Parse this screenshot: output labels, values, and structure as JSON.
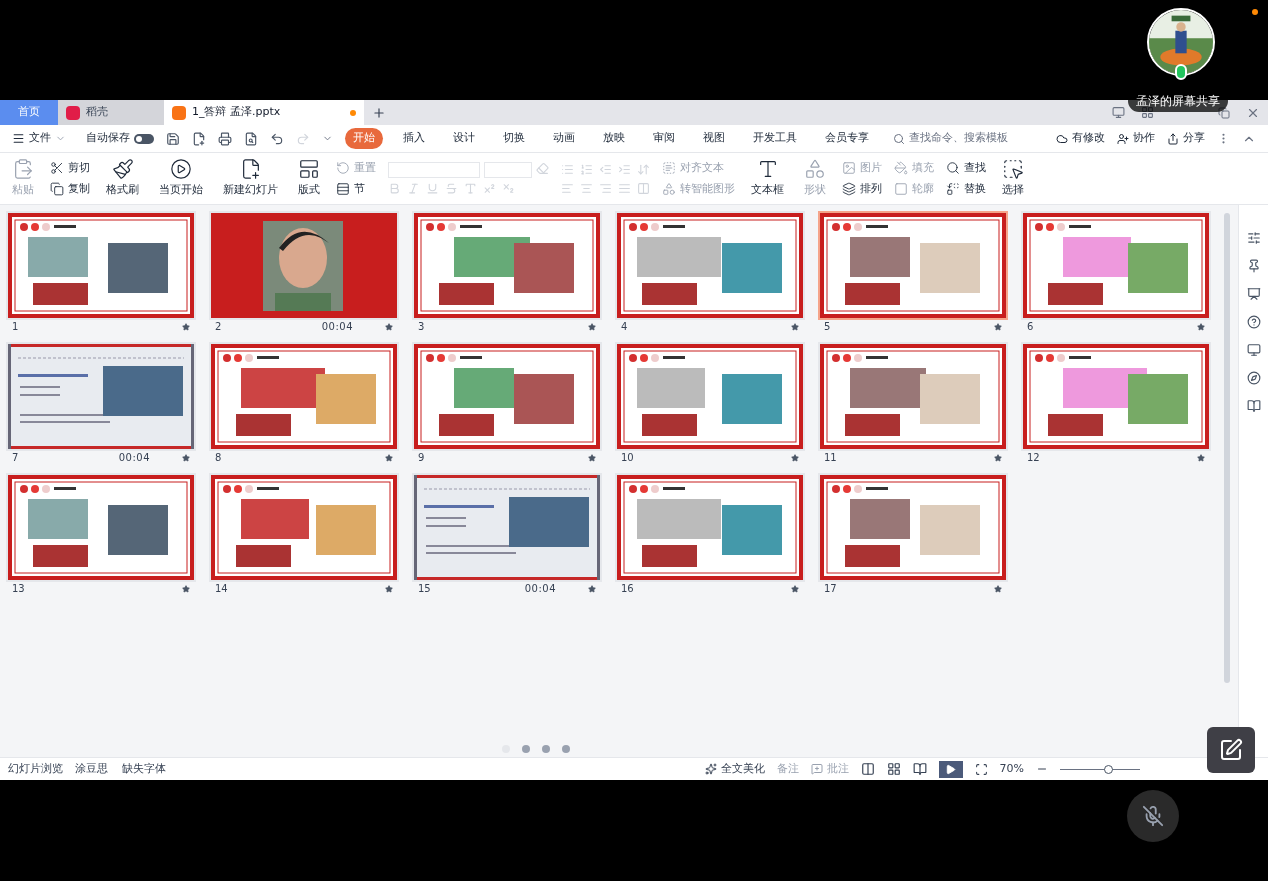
{
  "tabs": [
    {
      "label": "首页",
      "selected": false,
      "kind": "home"
    },
    {
      "label": "稻壳",
      "selected": false,
      "kind": "docer"
    },
    {
      "label": "1_答辩 孟泽.pptx",
      "selected": true,
      "kind": "file",
      "modified": true
    }
  ],
  "menu": {
    "file": "文件",
    "autosave": {
      "label": "自动保存",
      "on": false
    },
    "ribbon_tabs": [
      {
        "label": "开始",
        "selected": true
      },
      {
        "label": "插入",
        "selected": false
      },
      {
        "label": "设计",
        "selected": false
      },
      {
        "label": "切换",
        "selected": false
      },
      {
        "label": "动画",
        "selected": false
      },
      {
        "label": "放映",
        "selected": false
      },
      {
        "label": "审阅",
        "selected": false
      },
      {
        "label": "视图",
        "selected": false
      },
      {
        "label": "开发工具",
        "selected": false
      },
      {
        "label": "会员专享",
        "selected": false
      }
    ],
    "search": {
      "placeholder": "查找命令、搜索模板"
    },
    "right": [
      "有修改",
      "协作",
      "分享"
    ]
  },
  "ribbon": {
    "paste": {
      "label": "粘贴",
      "disabled": true
    },
    "cut": "剪切",
    "copy": "复制",
    "format_painter": "格式刷",
    "play_from_current": "当页开始",
    "new_slide": "新建幻灯片",
    "layout": "版式",
    "reset": {
      "label": "重置",
      "disabled": true
    },
    "section": "节",
    "align_text": {
      "label": "对齐文本",
      "disabled": true
    },
    "smart_art": {
      "label": "转智能图形",
      "disabled": true
    },
    "text_box": "文本框",
    "shape": {
      "label": "形状",
      "disabled": true
    },
    "picture": {
      "label": "图片",
      "disabled": true
    },
    "fill": {
      "label": "填充",
      "disabled": true
    },
    "arrange": {
      "label": "排列",
      "disabled": false
    },
    "outline": {
      "label": "轮廓",
      "disabled": true
    },
    "find": "查找",
    "replace": "替换",
    "select": "选择"
  },
  "slides": [
    {
      "number": "1",
      "kind": "red-frame",
      "selected": false
    },
    {
      "number": "2",
      "kind": "red-full",
      "timing": "00:04",
      "selected": false
    },
    {
      "number": "3",
      "kind": "red-frame",
      "selected": false
    },
    {
      "number": "4",
      "kind": "red-frame",
      "selected": false
    },
    {
      "number": "5",
      "kind": "red-frame",
      "selected": true
    },
    {
      "number": "6",
      "kind": "red-frame",
      "selected": false
    },
    {
      "number": "7",
      "kind": "gray",
      "timing": "00:04",
      "selected": false
    },
    {
      "number": "8",
      "kind": "red-frame",
      "selected": false
    },
    {
      "number": "9",
      "kind": "red-frame",
      "selected": false
    },
    {
      "number": "10",
      "kind": "red-frame",
      "selected": false
    },
    {
      "number": "11",
      "kind": "red-frame",
      "selected": false
    },
    {
      "number": "12",
      "kind": "red-frame",
      "selected": false
    },
    {
      "number": "13",
      "kind": "red-frame",
      "selected": false
    },
    {
      "number": "14",
      "kind": "red-frame",
      "selected": false
    },
    {
      "number": "15",
      "kind": "gray",
      "timing": "00:04",
      "selected": false
    },
    {
      "number": "16",
      "kind": "red-frame",
      "selected": false
    },
    {
      "number": "17",
      "kind": "red-frame",
      "selected": false
    }
  ],
  "pager": [
    {
      "selected": true
    },
    {
      "selected": false
    },
    {
      "selected": false
    },
    {
      "selected": false
    }
  ],
  "status_bar": {
    "left": [
      "幻灯片浏览",
      "涂豆思",
      "缺失字体"
    ],
    "beautify": "全文美化",
    "notes": {
      "label": "备注",
      "disabled": true
    },
    "comments": {
      "label": "批注",
      "disabled": true
    },
    "zoom": "70%",
    "zoom_slider": {
      "level": 0.6
    }
  },
  "share": {
    "label": "孟泽的屏幕共享",
    "mic_muted": true
  }
}
